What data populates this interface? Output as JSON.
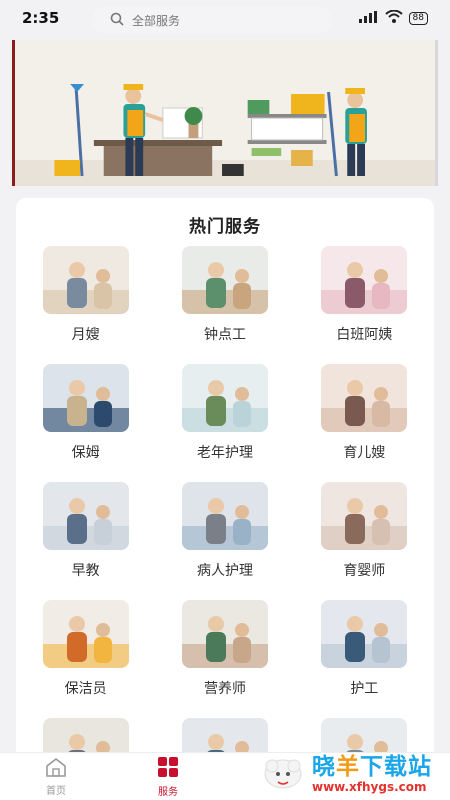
{
  "status_bar": {
    "time": "2:35",
    "signal": "HD",
    "battery": "88"
  },
  "search": {
    "placeholder": "全部服务"
  },
  "card": {
    "title": "热门服务"
  },
  "services": [
    {
      "label": "月嫂",
      "thumb": "cooking-photo"
    },
    {
      "label": "钟点工",
      "thumb": "kitchen-cleaning-photo"
    },
    {
      "label": "白班阿姨",
      "thumb": "baby-care-photo"
    },
    {
      "label": "保姆",
      "thumb": "housekeeping-photo"
    },
    {
      "label": "老年护理",
      "thumb": "elderly-care-photo"
    },
    {
      "label": "育儿嫂",
      "thumb": "nanny-photo"
    },
    {
      "label": "早教",
      "thumb": "early-education-photo"
    },
    {
      "label": "病人护理",
      "thumb": "patient-care-photo"
    },
    {
      "label": "育婴师",
      "thumb": "infant-care-photo"
    },
    {
      "label": "保洁员",
      "thumb": "cleaner-photo"
    },
    {
      "label": "营养师",
      "thumb": "nutritionist-photo"
    },
    {
      "label": "护工",
      "thumb": "nurse-aide-photo"
    },
    {
      "label": "",
      "thumb": "child-photo"
    },
    {
      "label": "",
      "thumb": "nurse-photo"
    },
    {
      "label": "",
      "thumb": "hospital-photo"
    }
  ],
  "tabbar": {
    "home": {
      "label": "首页",
      "icon": "home-icon"
    },
    "services": {
      "label": "服务",
      "icon": "grid-icon"
    }
  },
  "watermark": {
    "brand_part1": "晓",
    "brand_part2": "羊",
    "brand_part3": "下载站",
    "url": "www.xfhygs.com"
  },
  "colors": {
    "accent": "#c8102e",
    "watermark_blue": "#1aa6e8",
    "watermark_orange": "#f29b18"
  }
}
